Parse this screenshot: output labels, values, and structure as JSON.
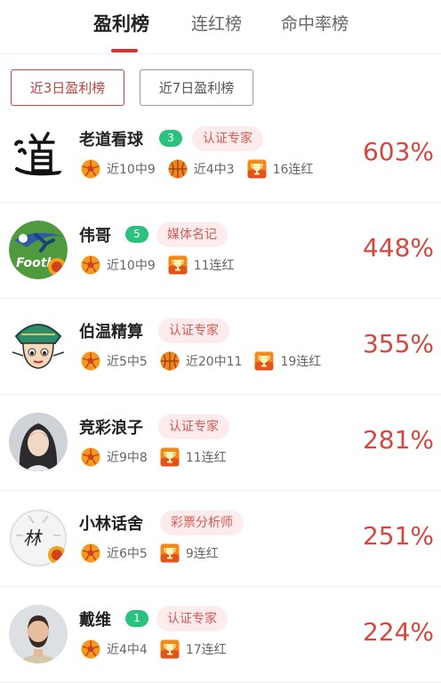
{
  "tabs": [
    {
      "label": "盈利榜",
      "active": true
    },
    {
      "label": "连红榜",
      "active": false
    },
    {
      "label": "命中率榜",
      "active": false
    }
  ],
  "filters": [
    {
      "label": "近3日盈利榜",
      "active": true
    },
    {
      "label": "近7日盈利榜",
      "active": false
    }
  ],
  "experts": [
    {
      "name": "老道看球",
      "level": "3",
      "tag": "认证专家",
      "avatar": "calligraphy-dao-avatar",
      "stats": [
        {
          "icon": "football-icon",
          "text": "近10中9"
        },
        {
          "icon": "basketball-icon",
          "text": "近4中3"
        },
        {
          "icon": "trophy-icon",
          "text": "16连红"
        }
      ],
      "percent": "603%"
    },
    {
      "name": "伟哥",
      "level": "5",
      "tag": "媒体名记",
      "avatar": "football-logo-avatar",
      "stats": [
        {
          "icon": "football-icon",
          "text": "近10中9"
        },
        {
          "icon": "trophy-icon",
          "text": "11连红"
        }
      ],
      "percent": "448%"
    },
    {
      "name": "伯温精算",
      "level": "",
      "tag": "认证专家",
      "avatar": "cartoon-man-avatar",
      "stats": [
        {
          "icon": "football-icon",
          "text": "近5中5"
        },
        {
          "icon": "basketball-icon",
          "text": "近20中11"
        },
        {
          "icon": "trophy-icon",
          "text": "19连红"
        }
      ],
      "percent": "355%"
    },
    {
      "name": "竞彩浪子",
      "level": "",
      "tag": "认证专家",
      "avatar": "long-hair-man-avatar",
      "stats": [
        {
          "icon": "football-icon",
          "text": "近9中8"
        },
        {
          "icon": "trophy-icon",
          "text": "11连红"
        }
      ],
      "percent": "281%"
    },
    {
      "name": "小林话舍",
      "level": "",
      "tag": "彩票分析师",
      "avatar": "ball-lin-avatar",
      "stats": [
        {
          "icon": "football-icon",
          "text": "近6中5"
        },
        {
          "icon": "trophy-icon",
          "text": "9连红"
        }
      ],
      "percent": "251%"
    },
    {
      "name": "戴维",
      "level": "1",
      "tag": "认证专家",
      "avatar": "bearded-man-avatar",
      "stats": [
        {
          "icon": "football-icon",
          "text": "近4中4"
        },
        {
          "icon": "trophy-icon",
          "text": "17连红"
        }
      ],
      "percent": "224%"
    }
  ],
  "colors": {
    "accent": "#d9322e",
    "level_badge": "#2bc17e",
    "tag_bg": "#fdeceb",
    "percent": "#d9453f"
  }
}
